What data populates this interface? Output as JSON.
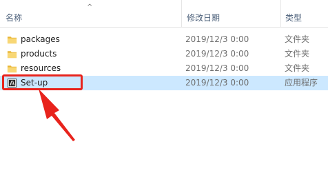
{
  "header": {
    "name_label": "名称",
    "date_label": "修改日期",
    "type_label": "类型",
    "sort_indicator": "^"
  },
  "files": [
    {
      "name": "packages",
      "modified": "2019/12/3 0:00",
      "type": "文件夹",
      "icon": "folder-icon",
      "selected": false
    },
    {
      "name": "products",
      "modified": "2019/12/3 0:00",
      "type": "文件夹",
      "icon": "folder-icon",
      "selected": false
    },
    {
      "name": "resources",
      "modified": "2019/12/3 0:00",
      "type": "文件夹",
      "icon": "folder-icon",
      "selected": false
    },
    {
      "name": "Set-up",
      "modified": "2019/12/3 0:00",
      "type": "应用程序",
      "icon": "adobe-app-icon",
      "selected": true
    }
  ],
  "colors": {
    "selection": "#cce8ff",
    "annotation": "#e8231c",
    "folder": "#f8d775"
  }
}
